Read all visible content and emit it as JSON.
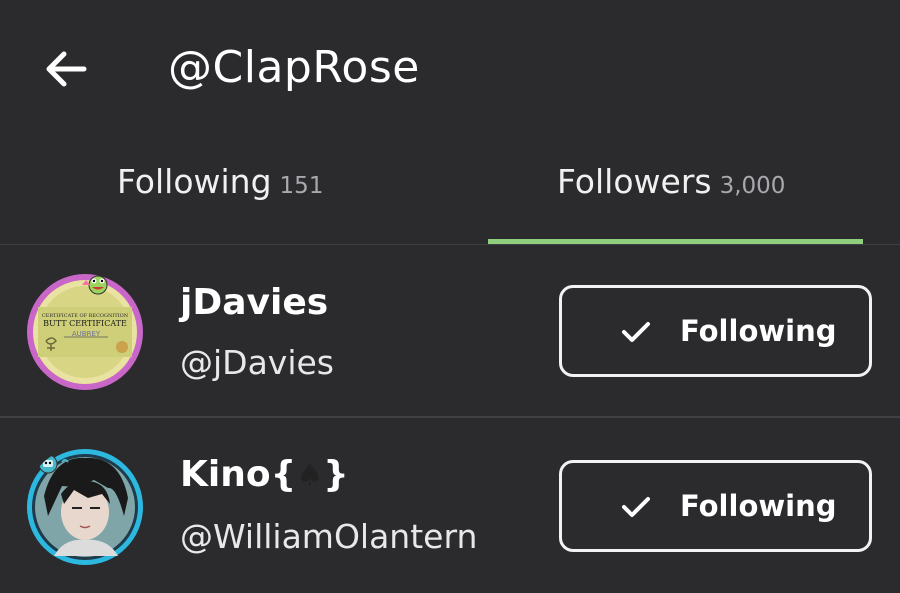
{
  "header": {
    "title": "@ClapRose",
    "back_icon": "arrow-left-icon"
  },
  "tabs": [
    {
      "label": "Following",
      "count": "151",
      "active": false
    },
    {
      "label": "Followers",
      "count": "3,000",
      "active": true
    }
  ],
  "followers": [
    {
      "name": "jDavies",
      "handle": "@jDavies",
      "button_label": "Following",
      "avatar_text_1": "CERTIFICATE OF RECOGNITION",
      "avatar_text_2": "BUTT CERTIFICATE",
      "avatar_text_3": "AUBREY"
    },
    {
      "name_prefix": "Kino{",
      "name_symbol": "♠",
      "name_suffix": "}",
      "handle": "@WilliamOlantern",
      "button_label": "Following"
    }
  ],
  "colors": {
    "background": "#2b2a2d",
    "accent": "#8fd07e",
    "text": "#ffffff",
    "muted": "#a9a8ad"
  }
}
